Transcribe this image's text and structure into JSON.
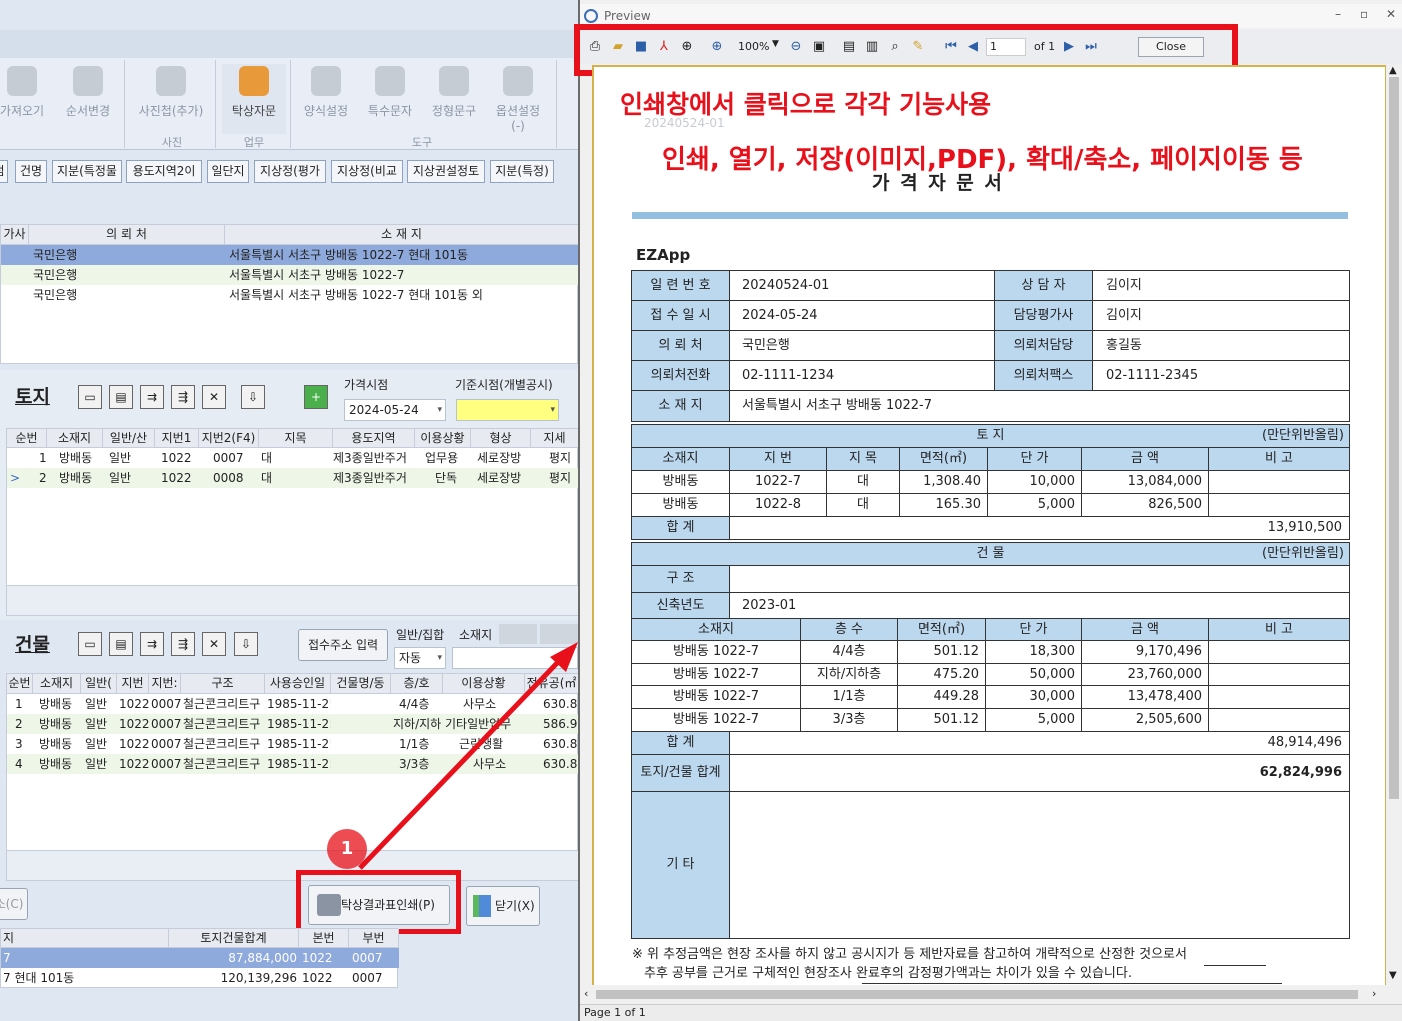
{
  "ribbon": {
    "buttons": [
      {
        "label": "가져오기"
      },
      {
        "label": "순서변경"
      },
      {
        "label": "사진첩(추가)"
      },
      {
        "label": "탁상자문"
      },
      {
        "label": "양식설정"
      },
      {
        "label": "특수문자"
      },
      {
        "label": "정형문구"
      },
      {
        "label": "옵션설정\n(-)"
      }
    ],
    "groups": [
      "사진",
      "업무",
      "도구"
    ]
  },
  "tabs": [
    "건명",
    "지분(특정물",
    "용도지역2이",
    "일단지",
    "지상정(평가",
    "지상정(비교",
    "지상권설정토",
    "지분(특정)"
  ],
  "top_grid": {
    "headers": [
      "가사",
      "의 뢰 처",
      "소 재 지"
    ],
    "rows": [
      [
        "국민은행",
        "서울특별시 서초구 방배동 1022-7 현대 101동"
      ],
      [
        "국민은행",
        "서울특별시 서초구 방배동 1022-7"
      ],
      [
        "국민은행",
        "서울특별시 서초구 방배동 1022-7 현대 101동 외"
      ]
    ]
  },
  "land": {
    "title": "토지",
    "price_time_label": "가격시점",
    "price_time": "2024-05-24",
    "base_time_label": "기준시점(개별공시)",
    "headers": [
      "순번",
      "소재지",
      "일반/산",
      "지번1",
      "지번2(F4)",
      "지목",
      "용도지역",
      "이용상황",
      "형상",
      "지세"
    ],
    "rows": [
      [
        "1",
        "방배동",
        "일반",
        "1022",
        "0007",
        "대",
        "제3종일반주거",
        "업무용",
        "세로장방",
        "평지"
      ],
      [
        "2",
        "방배동",
        "일반",
        "1022",
        "0008",
        "대",
        "제3종일반주거",
        "단독",
        "세로장방",
        "평지"
      ]
    ]
  },
  "building": {
    "title": "건물",
    "address_button": "접수주소 입력",
    "type_label": "일반/집합",
    "type_value": "자동",
    "address_label": "소재지",
    "headers": [
      "순번",
      "소재지",
      "일반(",
      "지번",
      "지번:",
      "구조",
      "사용승인일",
      "건물명/동",
      "층/호",
      "이용상황",
      "전유공(㎡"
    ],
    "rows": [
      [
        "1",
        "방배동",
        "일반",
        "1022",
        "0007",
        "철근콘크리트구",
        "1985-11-2!",
        "",
        "4/4층",
        "사무소",
        "630.8"
      ],
      [
        "2",
        "방배동",
        "일반",
        "1022",
        "0007",
        "철근콘크리트구",
        "1985-11-2!",
        "",
        "지하/지하",
        "기타일반업무",
        "586.9"
      ],
      [
        "3",
        "방배동",
        "일반",
        "1022",
        "0007",
        "철근콘크리트구",
        "1985-11-2!",
        "",
        "1/1층",
        "근린생활",
        "630.8"
      ],
      [
        "4",
        "방배동",
        "일반",
        "1022",
        "0007",
        "철근콘크리트구",
        "1985-11-2!",
        "",
        "3/3층",
        "사무소",
        "630.8"
      ]
    ]
  },
  "bottom": {
    "print_button": "탁상결과표인쇄(P)",
    "close_button": "닫기(X)",
    "left_button": "소(C)",
    "badge": "1",
    "headers": [
      "지",
      "토지건물합계",
      "본번",
      "부번"
    ],
    "rows": [
      [
        "7",
        "87,884,000",
        "1022",
        "0007"
      ],
      [
        "7 현대 101동",
        "120,139,296",
        "1022",
        "0007"
      ]
    ]
  },
  "preview": {
    "title": "Preview",
    "zoom": "100%",
    "page_input": "1",
    "page_of": "of 1",
    "close": "Close",
    "status": "Page 1 of 1"
  },
  "annotation": {
    "line1": "인쇄창에서 클릭으로 각각 기능사용",
    "line2": "인쇄, 열기, 저장(이미지,PDF), 확대/축소, 페이지이동 등"
  },
  "doc": {
    "title": "가 격 자 문 서",
    "company": "EZApp",
    "faded": "20240524-01",
    "info": [
      {
        "k1": "일 련 번 호",
        "v1": "20240524-01",
        "k2": "상 담 자",
        "v2": "김이지"
      },
      {
        "k1": "접 수 일 시",
        "v1": "2024-05-24",
        "k2": "담당평가사",
        "v2": "김이지"
      },
      {
        "k1": "의 뢰 처",
        "v1": "국민은행",
        "k2": "의뢰처담당",
        "v2": "홍길동"
      },
      {
        "k1": "의뢰처전화",
        "v1": "02-1111-1234",
        "k2": "의뢰처팩스",
        "v2": "02-1111-2345"
      }
    ],
    "addr_label": "소 재 지",
    "addr": "서울특별시 서초구 방배동 1022-7",
    "land_title": "토 지",
    "round_note": "(만단위반올림)",
    "land_headers": [
      "소재지",
      "지 번",
      "지 목",
      "면적(㎡)",
      "단 가",
      "금 액",
      "비 고"
    ],
    "land_rows": [
      [
        "방배동",
        "1022-7",
        "대",
        "1,308.40",
        "10,000",
        "13,084,000",
        ""
      ],
      [
        "방배동",
        "1022-8",
        "대",
        "165.30",
        "5,000",
        "826,500",
        ""
      ]
    ],
    "total_label": "합 계",
    "land_total": "13,910,500",
    "bld_title": "건 물",
    "struct_label": "구 조",
    "year_label": "신축년도",
    "year": "2023-01",
    "bld_headers": [
      "소재지",
      "층 수",
      "면적(㎡)",
      "단 가",
      "금 액",
      "비 고"
    ],
    "bld_rows": [
      [
        "방배동 1022-7",
        "4/4층",
        "501.12",
        "18,300",
        "9,170,496",
        ""
      ],
      [
        "방배동 1022-7",
        "지하/지하층",
        "475.20",
        "50,000",
        "23,760,000",
        ""
      ],
      [
        "방배동 1022-7",
        "1/1층",
        "449.28",
        "30,000",
        "13,478,400",
        ""
      ],
      [
        "방배동 1022-7",
        "3/3층",
        "501.12",
        "5,000",
        "2,505,600",
        ""
      ]
    ],
    "bld_total": "48,914,496",
    "grand_label": "토지/건물 합계",
    "grand_total": "62,824,996",
    "etc_label": "기 타",
    "note1": "※ 위 추정금액은 현장 조사를 하지 않고 공시지가 등 제반자료를 참고하여 개략적으로 산정한 것으로서",
    "note2": "추후 공부를 근거로 구체적인 현장조사 완료후의 감정평가액과는 차이가 있을 수 있습니다."
  },
  "colors": {
    "accent_red": "#e8101a",
    "header_blue": "#bcd8ef",
    "select_row": "#8ea9db"
  }
}
